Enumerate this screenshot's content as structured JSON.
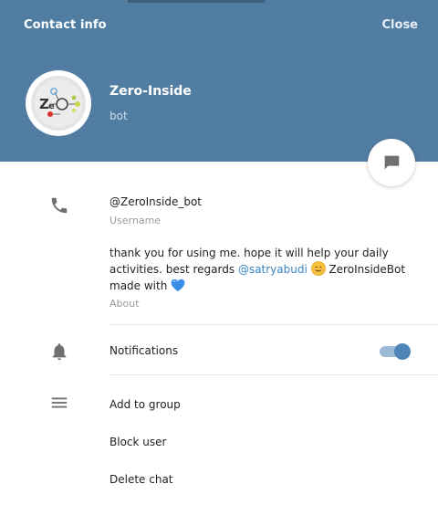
{
  "header": {
    "title": "Contact info",
    "close_label": "Close",
    "background_color": "#517da2"
  },
  "profile": {
    "name": "Zero-Inside",
    "status": "bot",
    "avatar_icon": "zero-inside-logo",
    "message_button_icon": "chat-bubble-icon"
  },
  "info": {
    "username": {
      "icon": "phone-icon",
      "value": "@ZeroInside_bot",
      "label": "Username"
    },
    "about": {
      "text_before_mention": "thank you for using me. hope it will help your daily activities. best regards ",
      "mention": "@satryabudi",
      "text_after_smile": " ZeroInsideBot made with ",
      "smile_emoji": "smiling-face-emoji",
      "heart_emoji": "blue-heart-emoji",
      "label": "About"
    }
  },
  "notifications": {
    "icon": "bell-icon",
    "label": "Notifications",
    "enabled": true,
    "accent_color": "#4e84b8"
  },
  "actions": {
    "icon": "menu-icon",
    "items": [
      {
        "label": "Add to group"
      },
      {
        "label": "Block user"
      },
      {
        "label": "Delete chat"
      }
    ]
  }
}
